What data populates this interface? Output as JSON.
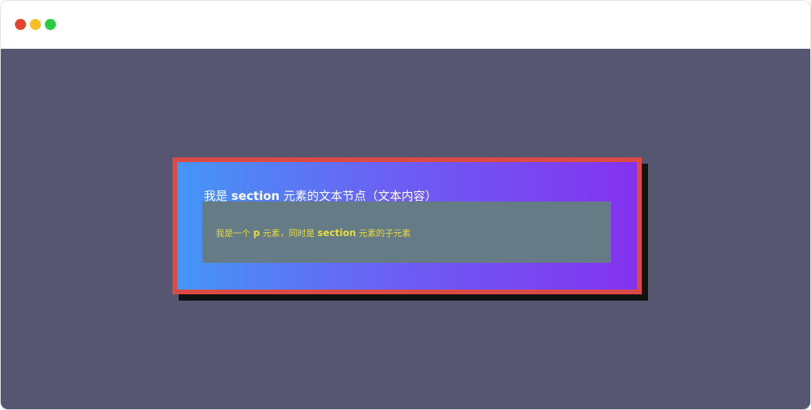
{
  "window": {
    "controls": [
      {
        "name": "close-button",
        "color": "#e2442f"
      },
      {
        "name": "minimize-button",
        "color": "#f6bf27"
      },
      {
        "name": "maximize-button",
        "color": "#2bcb43"
      }
    ]
  },
  "section": {
    "text_prefix": "我是 ",
    "text_keyword": "section",
    "text_suffix": " 元素的文本节点（文本内容）",
    "border_color": "#dc4a46",
    "gradient_start": "#4496f6",
    "gradient_end": "#8432ef"
  },
  "paragraph": {
    "text_prefix": "我是一个 ",
    "text_keyword_p": "p",
    "text_middle": " 元素，同时是 ",
    "text_keyword_section": "section",
    "text_suffix": " 元素的子元素",
    "background": "#657b86",
    "text_color": "#e7db3f"
  },
  "viewport": {
    "background": "#565670"
  }
}
